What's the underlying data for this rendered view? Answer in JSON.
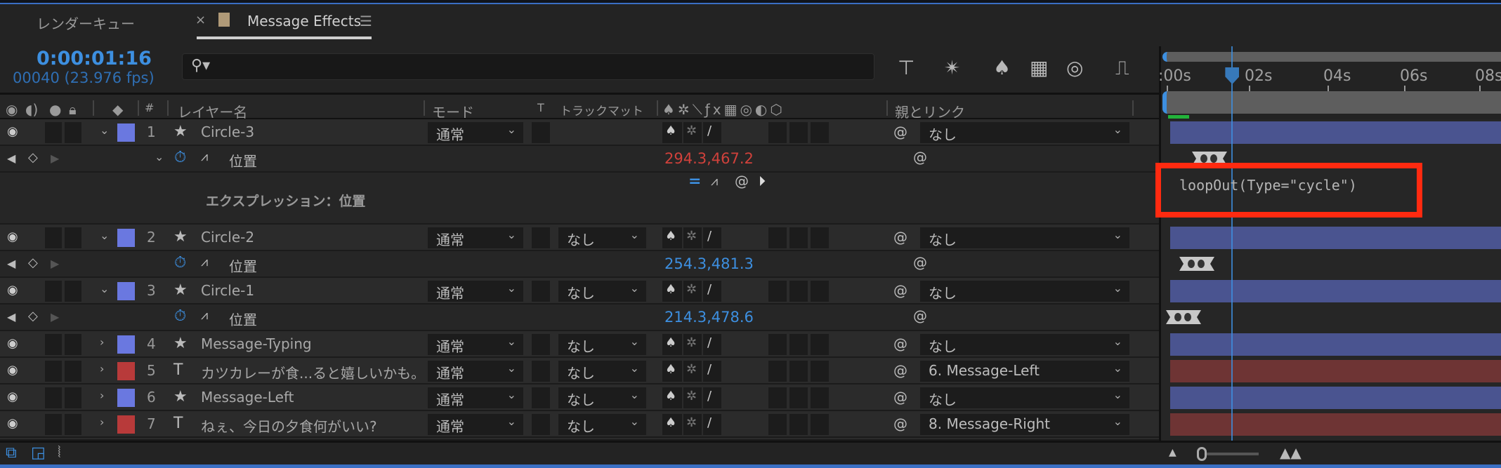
{
  "tabs": [
    {
      "label": "レンダーキュー",
      "active": false
    },
    {
      "label": "Message Effects",
      "active": true,
      "close": "×",
      "menu": "☰",
      "swatch": "#b09a78"
    }
  ],
  "composition": {
    "timecode": "0:00:01:16",
    "frame_info": "00040 (23.976 fps)",
    "search_placeholder": ""
  },
  "toolbar_icons": [
    "composition-flowchart-icon",
    "draft-3d-icon",
    "shy-layers-icon",
    "frame-blending-icon",
    "motion-blur-icon",
    "graph-editor-icon"
  ],
  "columns": {
    "eye": "visibility-icon",
    "audio": "audio-icon",
    "solo": "solo-icon",
    "lock": "lock-icon",
    "label": "label-tag-icon",
    "number": "#",
    "layer_name": "レイヤー名",
    "mode": "モード",
    "t": "T",
    "track_matte": "トラックマット",
    "switches": "switches",
    "parent": "親とリンク"
  },
  "ruler": {
    "ticks": [
      ":00s",
      "02s",
      "04s",
      "06s",
      "08s"
    ],
    "current_time_seconds": 1.67
  },
  "layers": [
    {
      "num": "1",
      "name": "Circle-3",
      "type": "shape",
      "color": "#6a78e0",
      "expanded": true,
      "mode": "通常",
      "track_matte": null,
      "parent": "なし",
      "bar": "#4a5490",
      "property": {
        "name": "位置",
        "value": "294.3,467.2",
        "value_color": "#d0413b",
        "expanded": true,
        "expression": {
          "label": "エクスプレッション：位置",
          "code": "loopOut(Type=\"cycle\")"
        }
      }
    },
    {
      "num": "2",
      "name": "Circle-2",
      "type": "shape",
      "color": "#6a78e0",
      "expanded": true,
      "mode": "通常",
      "track_matte": "なし",
      "parent": "なし",
      "bar": "#4a5490",
      "property": {
        "name": "位置",
        "value": "254.3,481.3",
        "value_color": "#3d8fe0"
      }
    },
    {
      "num": "3",
      "name": "Circle-1",
      "type": "shape",
      "color": "#6a78e0",
      "expanded": true,
      "mode": "通常",
      "track_matte": "なし",
      "parent": "なし",
      "bar": "#4a5490",
      "property": {
        "name": "位置",
        "value": "214.3,478.6",
        "value_color": "#3d8fe0"
      }
    },
    {
      "num": "4",
      "name": "Message-Typing",
      "type": "shape",
      "color": "#6a78e0",
      "expanded": false,
      "mode": "通常",
      "track_matte": "なし",
      "parent": "なし",
      "bar": "#4a5490"
    },
    {
      "num": "5",
      "name": "カツカレーが食...ると嬉しいかも。",
      "type": "text",
      "color": "#b83a3a",
      "expanded": false,
      "mode": "通常",
      "track_matte": "なし",
      "parent": "6. Message-Left",
      "bar": "#6e3434"
    },
    {
      "num": "6",
      "name": "Message-Left",
      "type": "shape",
      "color": "#6a78e0",
      "expanded": false,
      "mode": "通常",
      "track_matte": "なし",
      "parent": "なし",
      "bar": "#4a5490"
    },
    {
      "num": "7",
      "name": "ねぇ、今日の夕食何がいい?",
      "type": "text",
      "color": "#b83a3a",
      "expanded": false,
      "mode": "通常",
      "track_matte": "なし",
      "parent": "8. Message-Right",
      "bar": "#6e3434"
    }
  ],
  "highlight_color": "#ff2a10",
  "colors": {
    "accent": "#3d8fe0",
    "background": "#232323"
  }
}
